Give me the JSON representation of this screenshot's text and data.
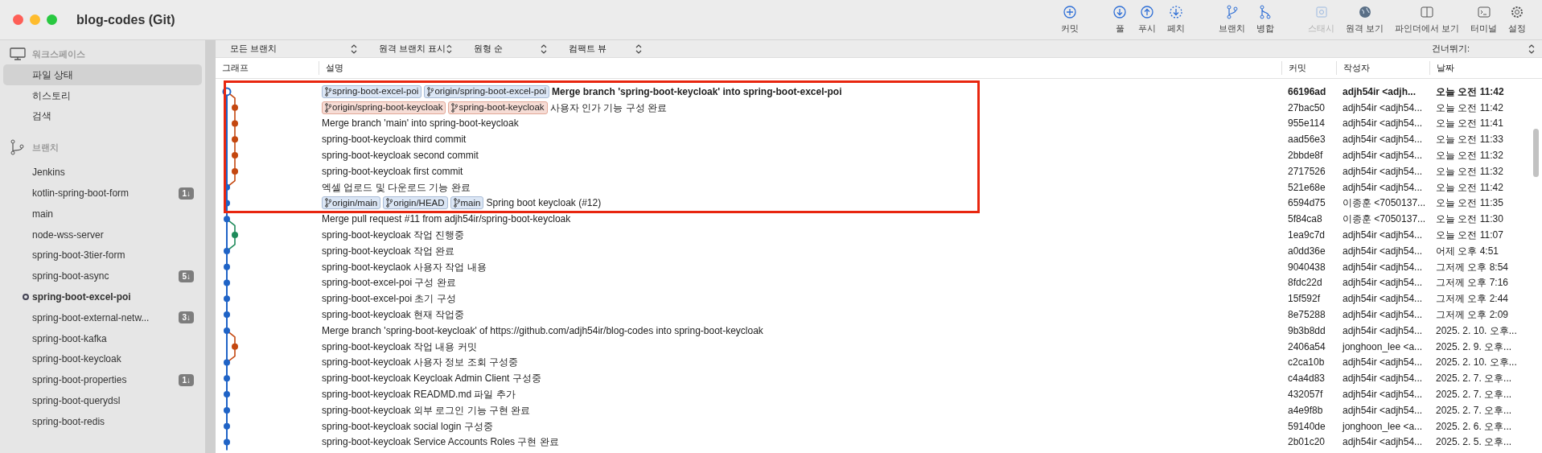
{
  "window": {
    "title": "blog-codes (Git)"
  },
  "toolbar": [
    [
      {
        "kind": "commit",
        "label": "커밋",
        "disabled": false
      }
    ],
    [
      {
        "kind": "pull",
        "label": "풀",
        "disabled": false
      },
      {
        "kind": "push",
        "label": "푸시",
        "disabled": false
      },
      {
        "kind": "fetch",
        "label": "페치",
        "disabled": false
      }
    ],
    [
      {
        "kind": "branch",
        "label": "브랜치",
        "disabled": false
      },
      {
        "kind": "merge",
        "label": "병합",
        "disabled": false
      }
    ],
    [
      {
        "kind": "stash",
        "label": "스태시",
        "disabled": true
      },
      {
        "kind": "remote",
        "label": "원격 보기",
        "disabled": false
      },
      {
        "kind": "finder",
        "label": "파인더에서 보기",
        "disabled": false
      },
      {
        "kind": "terminal",
        "label": "터미널",
        "disabled": false
      },
      {
        "kind": "settings",
        "label": "설정",
        "disabled": false
      }
    ]
  ],
  "sidebar": {
    "workspace": {
      "label": "워크스페이스",
      "items": [
        {
          "label": "파일 상태",
          "selected": true
        },
        {
          "label": "히스토리",
          "selected": false
        },
        {
          "label": "검색",
          "selected": false
        }
      ]
    },
    "branches": {
      "label": "브랜치",
      "items": [
        {
          "label": "Jenkins",
          "current": false
        },
        {
          "label": "kotlin-spring-boot-form",
          "current": false,
          "badge": "1↓"
        },
        {
          "label": "main",
          "current": false
        },
        {
          "label": "node-wss-server",
          "current": false
        },
        {
          "label": "spring-boot-3tier-form",
          "current": false
        },
        {
          "label": "spring-boot-async",
          "current": false,
          "badge": "5↓"
        },
        {
          "label": "spring-boot-excel-poi",
          "current": true
        },
        {
          "label": "spring-boot-external-netw...",
          "current": false,
          "badge": "3↓"
        },
        {
          "label": "spring-boot-kafka",
          "current": false
        },
        {
          "label": "spring-boot-keycloak",
          "current": false
        },
        {
          "label": "spring-boot-properties",
          "current": false,
          "badge": "1↓"
        },
        {
          "label": "spring-boot-querydsl",
          "current": false
        },
        {
          "label": "spring-boot-redis",
          "current": false
        }
      ]
    }
  },
  "filters": [
    {
      "label": "모든 브랜치",
      "kind": "wide"
    },
    {
      "label": "원격 브랜치 표시",
      "kind": "narrow"
    },
    {
      "label": "원형 순",
      "kind": "narrow"
    },
    {
      "label": "컴팩트 뷰",
      "kind": "narrow"
    }
  ],
  "jump": {
    "label": "건너뛰기:"
  },
  "table": {
    "columns": [
      "그래프",
      "설명",
      "커밋",
      "작성자",
      "날짜"
    ],
    "highlighted_rows": [
      {
        "kind": "main",
        "color": "#1f63c6",
        "head": true,
        "refs": [
          {
            "label": "spring-boot-excel-poi",
            "color": "#dbe6f5"
          },
          {
            "label": "origin/spring-boot-excel-poi",
            "color": "#dbe6f5"
          }
        ],
        "message": "Merge branch 'spring-boot-keycloak' into spring-boot-excel-poi",
        "commit": "66196ad",
        "author": "adjh54ir <adjh...",
        "date": "오늘 오전 11:42"
      },
      {
        "kind": "branch",
        "color": "#c4470f",
        "head": false,
        "refs": [
          {
            "label": "origin/spring-boot-keycloak",
            "color": "#f6dcd5"
          },
          {
            "label": "spring-boot-keycloak",
            "color": "#f6dcd5"
          }
        ],
        "message": "사용자 인가 기능 구성 완료",
        "commit": "27bac50",
        "author": "adjh54ir <adjh54...",
        "date": "오늘 오전 11:42"
      },
      {
        "kind": "branch",
        "color": "#c4470f",
        "head": false,
        "message": "Merge branch 'main' into spring-boot-keycloak",
        "commit": "955e114",
        "author": "adjh54ir <adjh54...",
        "date": "오늘 오전 11:41"
      },
      {
        "kind": "branch",
        "color": "#c4470f",
        "head": false,
        "message": "spring-boot-keycloak third commit",
        "commit": "aad56e3",
        "author": "adjh54ir <adjh54...",
        "date": "오늘 오전 11:33"
      },
      {
        "kind": "branch",
        "color": "#c4470f",
        "head": false,
        "message": "spring-boot-keycloak second commit",
        "commit": "2bbde8f",
        "author": "adjh54ir <adjh54...",
        "date": "오늘 오전 11:32"
      },
      {
        "kind": "branch",
        "color": "#c4470f",
        "head": false,
        "message": "spring-boot-keycloak first commit",
        "commit": "2717526",
        "author": "adjh54ir <adjh54...",
        "date": "오늘 오전 11:32"
      },
      {
        "kind": "main",
        "color": "#1f63c6",
        "head": false,
        "message": "엑셀 업로드 및 다운로드 기능 완료",
        "commit": "521e68e",
        "author": "adjh54ir <adjh54...",
        "date": "오늘 오전 11:42"
      },
      {
        "kind": "main",
        "color": "#1f63c6",
        "head": false,
        "refs": [
          {
            "label": "origin/main",
            "color": "#dbe6f5"
          },
          {
            "label": "origin/HEAD",
            "color": "#dbe6f5"
          },
          {
            "label": "main",
            "color": "#dbe6f5"
          }
        ],
        "message": "Spring boot keycloak (#12)",
        "commit": "6594d75",
        "author": "이종훈 <7050137...",
        "date": "오늘 오전 11:35"
      }
    ],
    "rows": [
      {
        "kind": "main",
        "color": "#1f63c6",
        "head": false,
        "message": "Merge pull request #11 from adjh54ir/spring-boot-keycloak",
        "commit": "5f84ca8",
        "author": "이종훈 <7050137...",
        "date": "오늘 오전 11:30"
      },
      {
        "kind": "branch",
        "color": "#1e8a5a",
        "head": false,
        "message": "spring-boot-keycloak 작업 진행중",
        "commit": "1ea9c7d",
        "author": "adjh54ir <adjh54...",
        "date": "오늘 오전 11:07"
      },
      {
        "kind": "main",
        "color": "#1f63c6",
        "head": false,
        "message": "spring-boot-keycloak 작업 완료",
        "commit": "a0dd36e",
        "author": "adjh54ir <adjh54...",
        "date": "어제 오후 4:51"
      },
      {
        "kind": "main",
        "color": "#1f63c6",
        "head": false,
        "message": "spring-boot-keyclaok 사용자 작업 내용",
        "commit": "9040438",
        "author": "adjh54ir <adjh54...",
        "date": "그저께 오후 8:54"
      },
      {
        "kind": "main",
        "color": "#1f63c6",
        "head": false,
        "message": "spring-boot-excel-poi 구성 완료",
        "commit": "8fdc22d",
        "author": "adjh54ir <adjh54...",
        "date": "그저께 오후 7:16"
      },
      {
        "kind": "main",
        "color": "#1f63c6",
        "head": false,
        "message": "spring-boot-excel-poi 초기 구성",
        "commit": "15f592f",
        "author": "adjh54ir <adjh54...",
        "date": "그저께 오후 2:44"
      },
      {
        "kind": "main",
        "color": "#1f63c6",
        "head": false,
        "message": "spring-boot-keycloak 현재 작업중",
        "commit": "8e75288",
        "author": "adjh54ir <adjh54...",
        "date": "그저께 오후 2:09"
      },
      {
        "kind": "main",
        "color": "#1f63c6",
        "head": false,
        "message": "Merge branch 'spring-boot-keycloak' of https://github.com/adjh54ir/blog-codes into spring-boot-keycloak",
        "commit": "9b3b8dd",
        "author": "adjh54ir <adjh54...",
        "date": "2025. 2. 10. 오후..."
      },
      {
        "kind": "branch",
        "color": "#c4470f",
        "head": false,
        "message": "spring-boot-keycloak 작업 내용 커밋",
        "commit": "2406a54",
        "author": "jonghoon_lee <a...",
        "date": "2025. 2. 9. 오후..."
      },
      {
        "kind": "main",
        "color": "#1f63c6",
        "head": false,
        "message": "spring-boot-keycloak 사용자 정보 조회 구성중",
        "commit": "c2ca10b",
        "author": "adjh54ir <adjh54...",
        "date": "2025. 2. 10. 오후..."
      },
      {
        "kind": "main",
        "color": "#1f63c6",
        "head": false,
        "message": "spring-boot-keycloak Keycloak Admin Client 구성중",
        "commit": "c4a4d83",
        "author": "adjh54ir <adjh54...",
        "date": "2025. 2. 7. 오후..."
      },
      {
        "kind": "main",
        "color": "#1f63c6",
        "head": false,
        "message": "spring-boot-keycloak READMD.md 파일 추가",
        "commit": "432057f",
        "author": "adjh54ir <adjh54...",
        "date": "2025. 2. 7. 오후..."
      },
      {
        "kind": "main",
        "color": "#1f63c6",
        "head": false,
        "message": "spring-boot-keycloak 외부 로그인 기능 구현 완료",
        "commit": "a4e9f8b",
        "author": "adjh54ir <adjh54...",
        "date": "2025. 2. 7. 오후..."
      },
      {
        "kind": "main",
        "color": "#1f63c6",
        "head": false,
        "message": "spring-boot-keycloak social login 구성중",
        "commit": "59140de",
        "author": "jonghoon_lee <a...",
        "date": "2025. 2. 6. 오후..."
      },
      {
        "kind": "main",
        "color": "#1f63c6",
        "head": false,
        "message": "spring-boot-keycloak Service Accounts Roles 구현 완료",
        "commit": "2b01c20",
        "author": "adjh54ir <adjh54...",
        "date": "2025. 2. 5. 오후..."
      }
    ]
  }
}
